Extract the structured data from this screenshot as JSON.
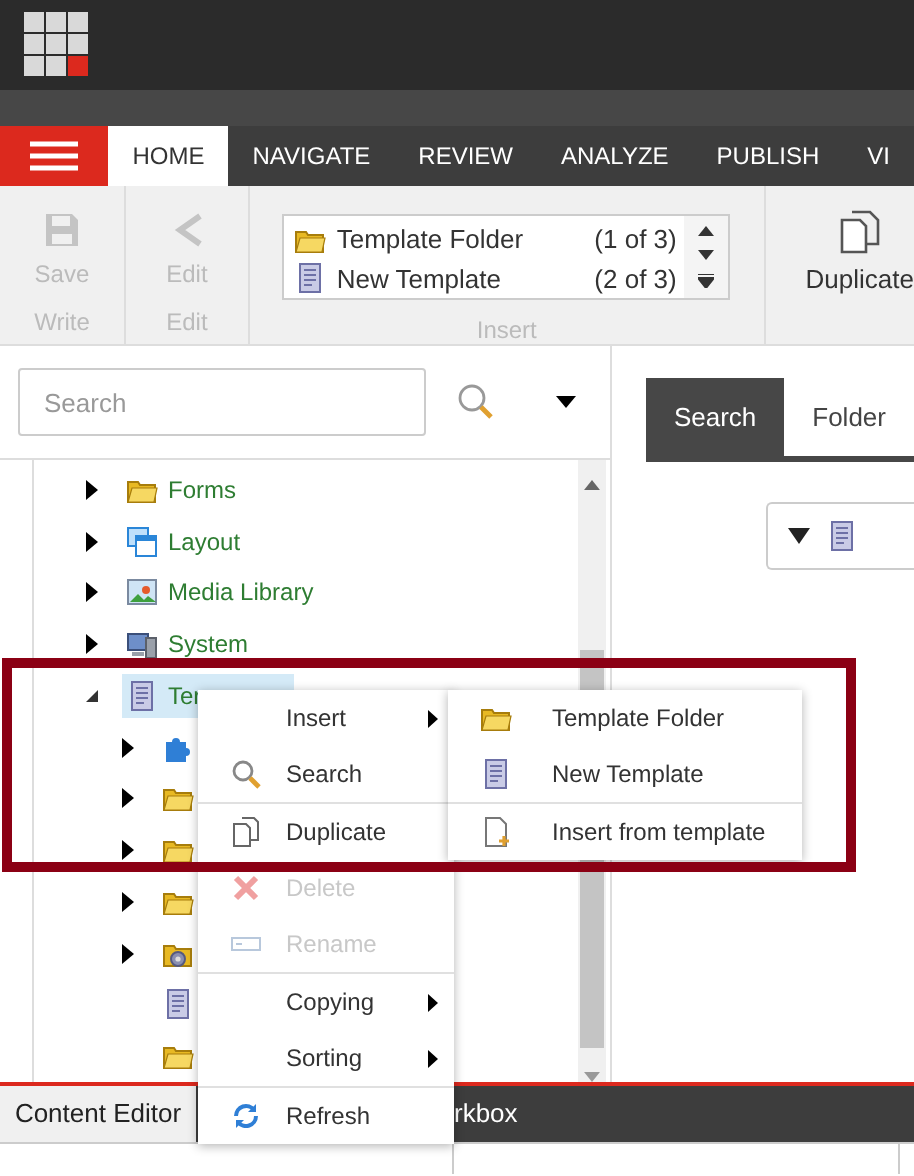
{
  "ribbon_tabs": [
    {
      "label": "HOME",
      "selected": true
    },
    {
      "label": "NAVIGATE",
      "selected": false
    },
    {
      "label": "REVIEW",
      "selected": false
    },
    {
      "label": "ANALYZE",
      "selected": false
    },
    {
      "label": "PUBLISH",
      "selected": false
    },
    {
      "label": "VI",
      "selected": false
    }
  ],
  "ribbon": {
    "write": {
      "save": {
        "label": "Save",
        "disabled": true
      },
      "group": "Write"
    },
    "edit": {
      "button": {
        "label": "Edit",
        "disabled": true
      },
      "group": "Edit"
    },
    "insert": {
      "options": [
        {
          "kind": "folder",
          "label": "Template Folder",
          "count": "(1 of 3)"
        },
        {
          "kind": "template",
          "label": "New Template",
          "count": "(2 of 3)"
        }
      ],
      "group": "Insert"
    },
    "duplicate": {
      "label": "Duplicate"
    }
  },
  "search": {
    "placeholder": "Search"
  },
  "tree": [
    {
      "kind": "folder",
      "label": "Forms",
      "has_children": true,
      "expanded": false,
      "selected": false
    },
    {
      "kind": "layout",
      "label": "Layout",
      "has_children": true,
      "expanded": false,
      "selected": false
    },
    {
      "kind": "media",
      "label": "Media Library",
      "has_children": true,
      "expanded": false,
      "selected": false
    },
    {
      "kind": "system",
      "label": "System",
      "has_children": true,
      "expanded": false,
      "selected": false
    },
    {
      "kind": "template",
      "label": "Ter",
      "has_children": true,
      "expanded": true,
      "selected": true,
      "children": [
        {
          "kind": "puzzle",
          "has_children": true,
          "expanded": false
        },
        {
          "kind": "folder",
          "has_children": true,
          "expanded": false
        },
        {
          "kind": "folder",
          "has_children": true,
          "expanded": false
        },
        {
          "kind": "folder",
          "has_children": true,
          "expanded": false
        },
        {
          "kind": "gearfolder",
          "has_children": true,
          "expanded": false
        },
        {
          "kind": "template",
          "has_children": false
        },
        {
          "kind": "folder",
          "has_children": false
        }
      ]
    }
  ],
  "right_tabs": [
    {
      "label": "Search",
      "selected": true
    },
    {
      "label": "Folder",
      "selected": false
    }
  ],
  "bottom_tabs": [
    {
      "label": "Content Editor",
      "selected": true
    },
    {
      "label": "rkbox",
      "selected": false
    }
  ],
  "context_menu": {
    "groups": [
      [
        {
          "kind": "none",
          "label": "Insert",
          "disabled": false,
          "submenu": true
        },
        {
          "kind": "search",
          "label": "Search",
          "disabled": false,
          "submenu": false
        }
      ],
      [
        {
          "kind": "duplicate",
          "label": "Duplicate",
          "disabled": false,
          "submenu": false
        },
        {
          "kind": "delete",
          "label": "Delete",
          "disabled": true,
          "submenu": false
        },
        {
          "kind": "rename",
          "label": "Rename",
          "disabled": true,
          "submenu": false
        }
      ],
      [
        {
          "kind": "none",
          "label": "Copying",
          "disabled": false,
          "submenu": true
        },
        {
          "kind": "none",
          "label": "Sorting",
          "disabled": false,
          "submenu": true
        }
      ],
      [
        {
          "kind": "refresh",
          "label": "Refresh",
          "disabled": false,
          "submenu": false
        }
      ]
    ]
  },
  "submenu": {
    "groups": [
      [
        {
          "kind": "folder",
          "label": "Template Folder"
        },
        {
          "kind": "template",
          "label": "New Template"
        }
      ],
      [
        {
          "kind": "fromtemplate",
          "label": "Insert from template"
        }
      ]
    ]
  }
}
